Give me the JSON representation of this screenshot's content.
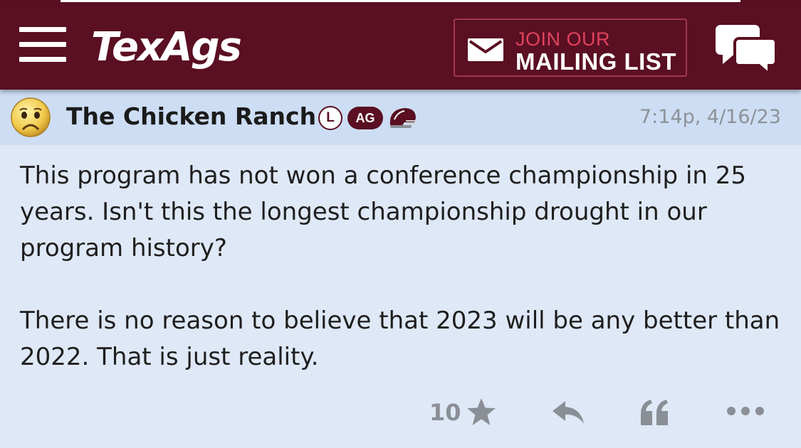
{
  "header": {
    "logo_text": "TexAgs",
    "mailing": {
      "line1": "JOIN OUR",
      "line2": "MAILING LIST"
    },
    "brand_color": "#5a0f22"
  },
  "post": {
    "username": "The Chicken Ranch",
    "badges": {
      "level": "L",
      "ag": "AG"
    },
    "timestamp": "7:14p, 4/16/23",
    "paragraphs": [
      "This program has not won a conference championship in 25 years. Isn't this the longest championship drought in our program history?",
      "There is no reason to believe that 2023 will be any better than 2022. That is just reality."
    ],
    "star_count": "10",
    "icons": [
      "sad-face-avatar",
      "helmet-icon",
      "star-icon",
      "reply-icon",
      "quote-icon",
      "more-icon",
      "chat-icon",
      "mail-icon",
      "hamburger-menu-icon"
    ]
  }
}
